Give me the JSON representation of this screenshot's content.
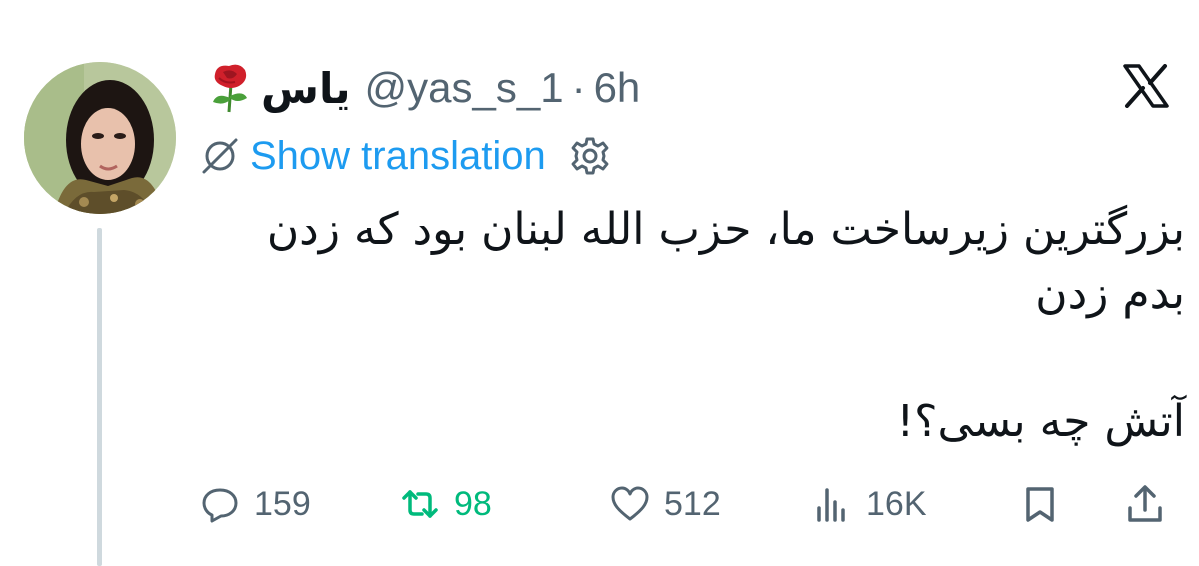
{
  "author": {
    "display_name": "یاس",
    "handle": "@yas_s_1",
    "separator": "·",
    "time": "6h",
    "name_emoji_icon": "rose-icon"
  },
  "platform_icon": "x-logo-icon",
  "translation": {
    "label": "Show translation",
    "icon": "translate-icon",
    "settings_icon": "gear-icon"
  },
  "tweet": {
    "line1": "بزرگترین زیرساخت ما، حزب الله لبنان بود که زدن",
    "line2": "بدم زدن",
    "line3": "آتش چه بسی؟!"
  },
  "actions": {
    "replies": "159",
    "retweets": "98",
    "likes": "512",
    "views": "16K"
  },
  "colors": {
    "link_blue": "#1d9bf0",
    "retweet_green": "#00ba7c",
    "muted_gray": "#536471",
    "thread_line": "#cfd9de"
  }
}
